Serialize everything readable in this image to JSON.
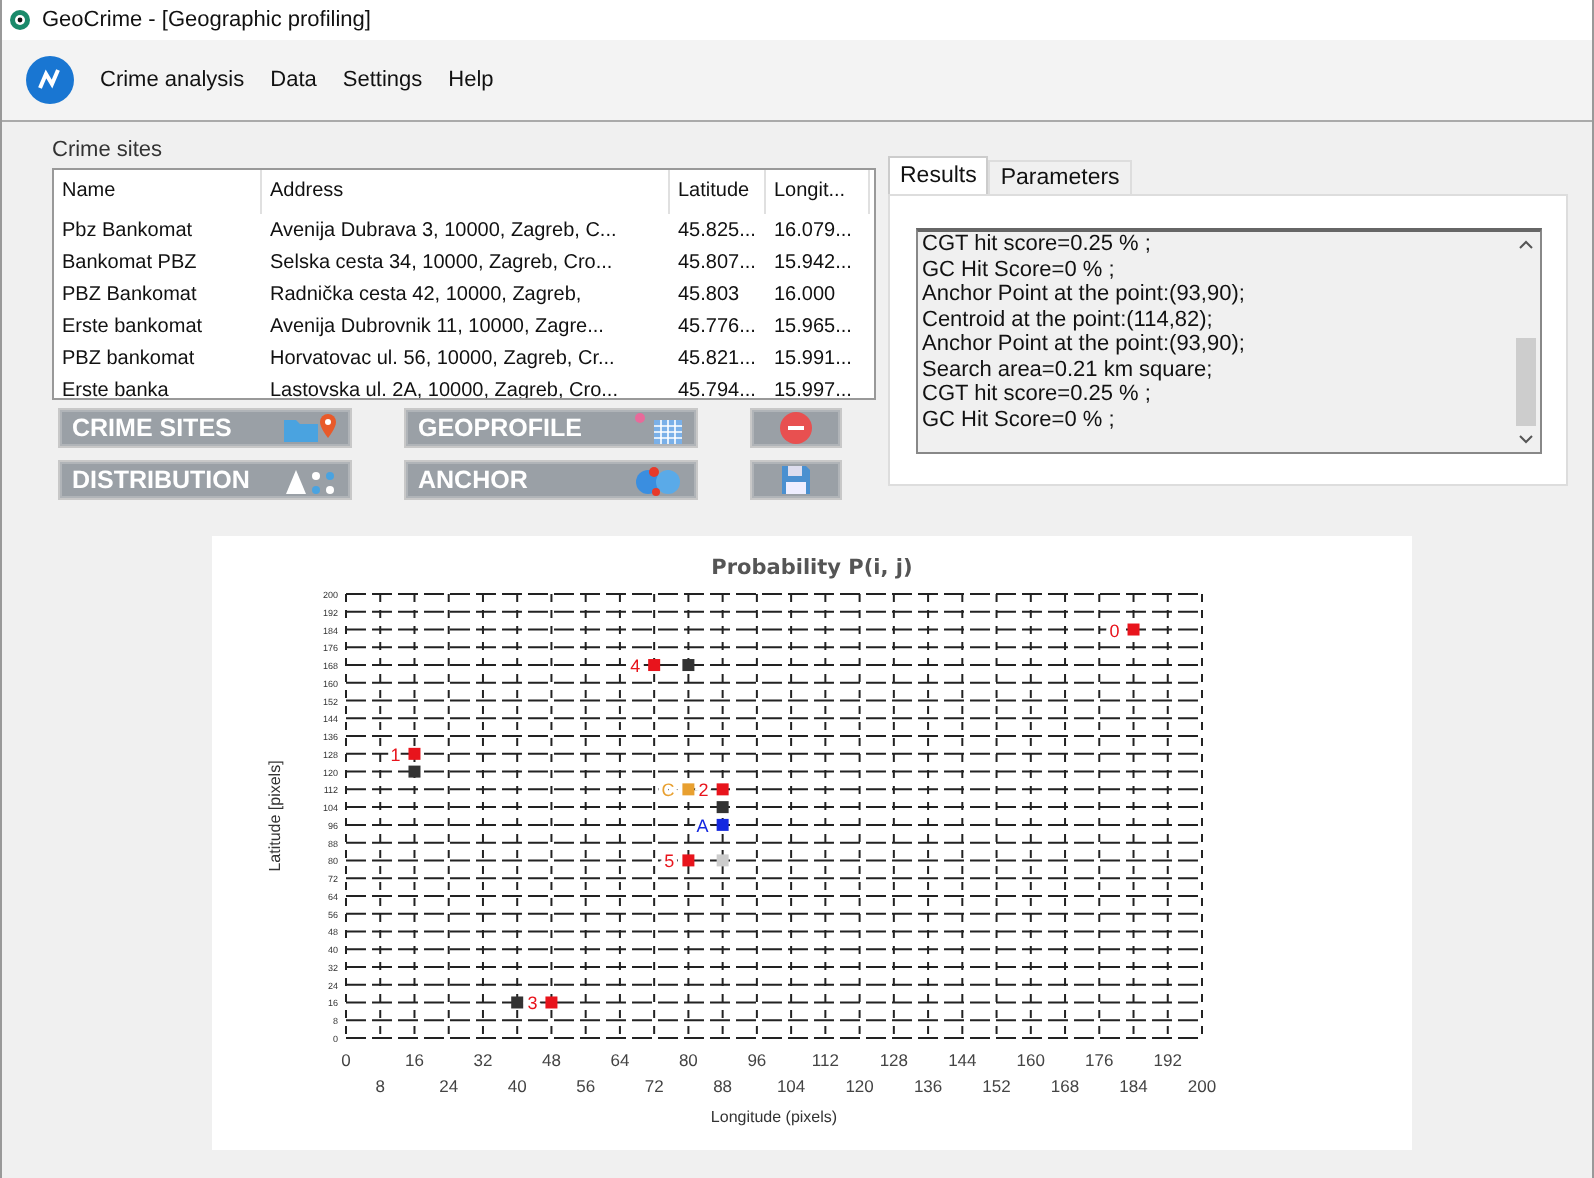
{
  "window": {
    "title": "GeoCrime  - [Geographic profiling]"
  },
  "menu": [
    "Crime analysis",
    "Data",
    "Settings",
    "Help"
  ],
  "crime_sites": {
    "title": "Crime sites",
    "columns": [
      "Name",
      "Address",
      "Latitude",
      "Longit..."
    ],
    "rows": [
      [
        "Pbz Bankomat",
        "Avenija Dubrava 3, 10000, Zagreb, C...",
        "45.825...",
        "16.079..."
      ],
      [
        "Bankomat PBZ",
        "Selska cesta 34, 10000, Zagreb, Cro...",
        "45.807...",
        "15.942..."
      ],
      [
        "PBZ Bankomat",
        "Radnička cesta 42, 10000, Zagreb,",
        "45.803",
        "16.000"
      ],
      [
        "Erste bankomat",
        "Avenija Dubrovnik 11, 10000, Zagre...",
        "45.776...",
        "15.965..."
      ],
      [
        "PBZ bankomat",
        "Horvatovac ul. 56, 10000, Zagreb, Cr...",
        "45.821...",
        "15.991..."
      ],
      [
        "Erste banka",
        "Lastovska ul. 2A, 10000, Zagreb, Cro...",
        "45.794...",
        "15.997..."
      ]
    ]
  },
  "buttons": [
    {
      "kind": "crime_sites",
      "label": "CRIME SITES"
    },
    {
      "kind": "geoprofile",
      "label": "GEOPROFILE"
    },
    {
      "kind": "delete"
    },
    {
      "kind": "distribution",
      "label": "DISTRIBUTION"
    },
    {
      "kind": "anchor",
      "label": "ANCHOR"
    },
    {
      "kind": "save"
    }
  ],
  "tabs": [
    {
      "label": "Results",
      "selected": true
    },
    {
      "label": "Parameters",
      "selected": false
    }
  ],
  "results": [
    "CGT hit score=0.25 % ;",
    "GC Hit Score=0 % ;",
    "Anchor Point at the point:(93,90);",
    "Centroid at the point:(114,82);",
    "Anchor Point at the point:(93,90);",
    "Search area=0.21 km square;",
    "CGT hit score=0.25 % ;",
    "GC Hit Score=0 % ;"
  ],
  "chart": {
    "chart_data": {
      "type": "scatter",
      "title": "Probability P(i, j)",
      "xlabel": "Longitude (pixels)",
      "ylabel": "Latitude [pixels]",
      "xlim": [
        0,
        200
      ],
      "ylim": [
        0,
        200
      ],
      "grid": true,
      "xticks": [
        0,
        16,
        32,
        48,
        64,
        80,
        96,
        112,
        128,
        144,
        160,
        176,
        192
      ],
      "yticks": [
        0,
        8,
        16,
        24,
        32,
        40,
        48,
        56,
        64,
        72,
        80,
        88,
        96,
        104,
        112,
        120,
        128,
        136,
        144,
        152,
        160,
        168,
        176,
        184,
        192,
        200
      ],
      "series": [
        {
          "color": "#e8141c",
          "x": [
            184,
            16,
            88,
            48,
            72,
            80
          ],
          "values": [
            184,
            128,
            112,
            16,
            168,
            80
          ]
        },
        {
          "color": "#e8a030",
          "x": [
            80
          ],
          "values": [
            112
          ]
        },
        {
          "color": "#1428e0",
          "x": [
            88
          ],
          "values": [
            96
          ]
        },
        {
          "color": "#333333",
          "x": [
            80,
            16,
            88,
            40
          ],
          "values": [
            168,
            120,
            104,
            16
          ]
        },
        {
          "color": "#cccccc",
          "x": [
            88
          ],
          "values": [
            80
          ]
        }
      ],
      "annotations": [
        "0",
        "1",
        "2",
        "3",
        "4",
        "5",
        "C",
        "A"
      ]
    },
    "lower_tick_labels": [
      "8",
      "24",
      "40",
      "56",
      "72",
      "88",
      "104",
      "120",
      "136",
      "152",
      "168",
      "184",
      "200"
    ]
  }
}
